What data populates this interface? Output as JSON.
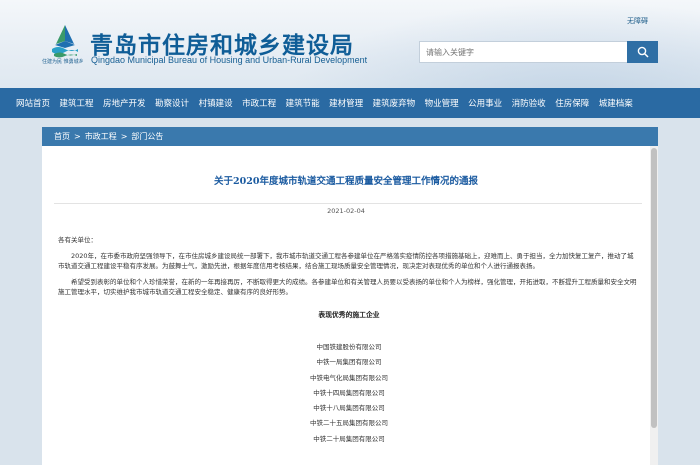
{
  "header": {
    "site_title": "青岛市住房和城乡建设局",
    "site_subtitle": "Qingdao Municipal Bureau of Housing and Urban-Rural Development",
    "slogan": "住建为民 惟勇城乡",
    "barrier_free": "无障碍",
    "search_placeholder": "请输入关键字"
  },
  "nav": {
    "items": [
      "网站首页",
      "建筑工程",
      "房地产开发",
      "勘察设计",
      "村镇建设",
      "市政工程",
      "建筑节能",
      "建材管理",
      "建筑废弃物",
      "物业管理",
      "公用事业",
      "消防验收",
      "住房保障",
      "城建档案"
    ]
  },
  "breadcrumb": {
    "items": [
      "首页",
      "市政工程",
      "部门公告"
    ],
    "separator": ">"
  },
  "article": {
    "title": "关于2020年度城市轨道交通工程质量安全管理工作情况的通报",
    "date": "2021-02-04",
    "salutation": "各有关单位：",
    "paragraph1": "2020年，在市委市政府坚强领导下，在市住房城乡建设局统一部署下，我市城市轨道交通工程各参建单位在严格落实疫情防控各项措施基础上，迎难而上、勇于担当，全力加快复工复产，推动了城市轨道交通工程建设平稳有序发展。为鼓舞士气，激励先进，根据年度信用考核结果，结合施工现场质量安全管理情况，现决定对表现优秀的单位和个人进行通报表扬。",
    "paragraph2": "希望受到表彰的单位和个人珍惜荣誉，在新的一年再接再厉，不断取得更大的成绩。各参建单位和有关管理人员要以受表扬的单位和个人为榜样，强化管理，开拓进取，不断提升工程质量和安全文明施工管理水平，切实维护我市城市轨道交通工程安全稳定、健康有序的良好形势。",
    "section_title": "表现优秀的施工企业",
    "companies": [
      "中国铁建股份有限公司",
      "中铁一局集团有限公司",
      "中铁电气化局集团有限公司",
      "中铁十四局集团有限公司",
      "中铁十八局集团有限公司",
      "中铁二十五局集团有限公司",
      "中铁二十局集团有限公司"
    ]
  },
  "colors": {
    "brand_blue": "#0f5d97",
    "nav_bg": "#2a6aa3",
    "breadcrumb_bg": "#3a79ad",
    "title_blue": "#1a5aa0"
  },
  "icons": {
    "logo": "sail-logo-icon",
    "search": "search-icon"
  }
}
